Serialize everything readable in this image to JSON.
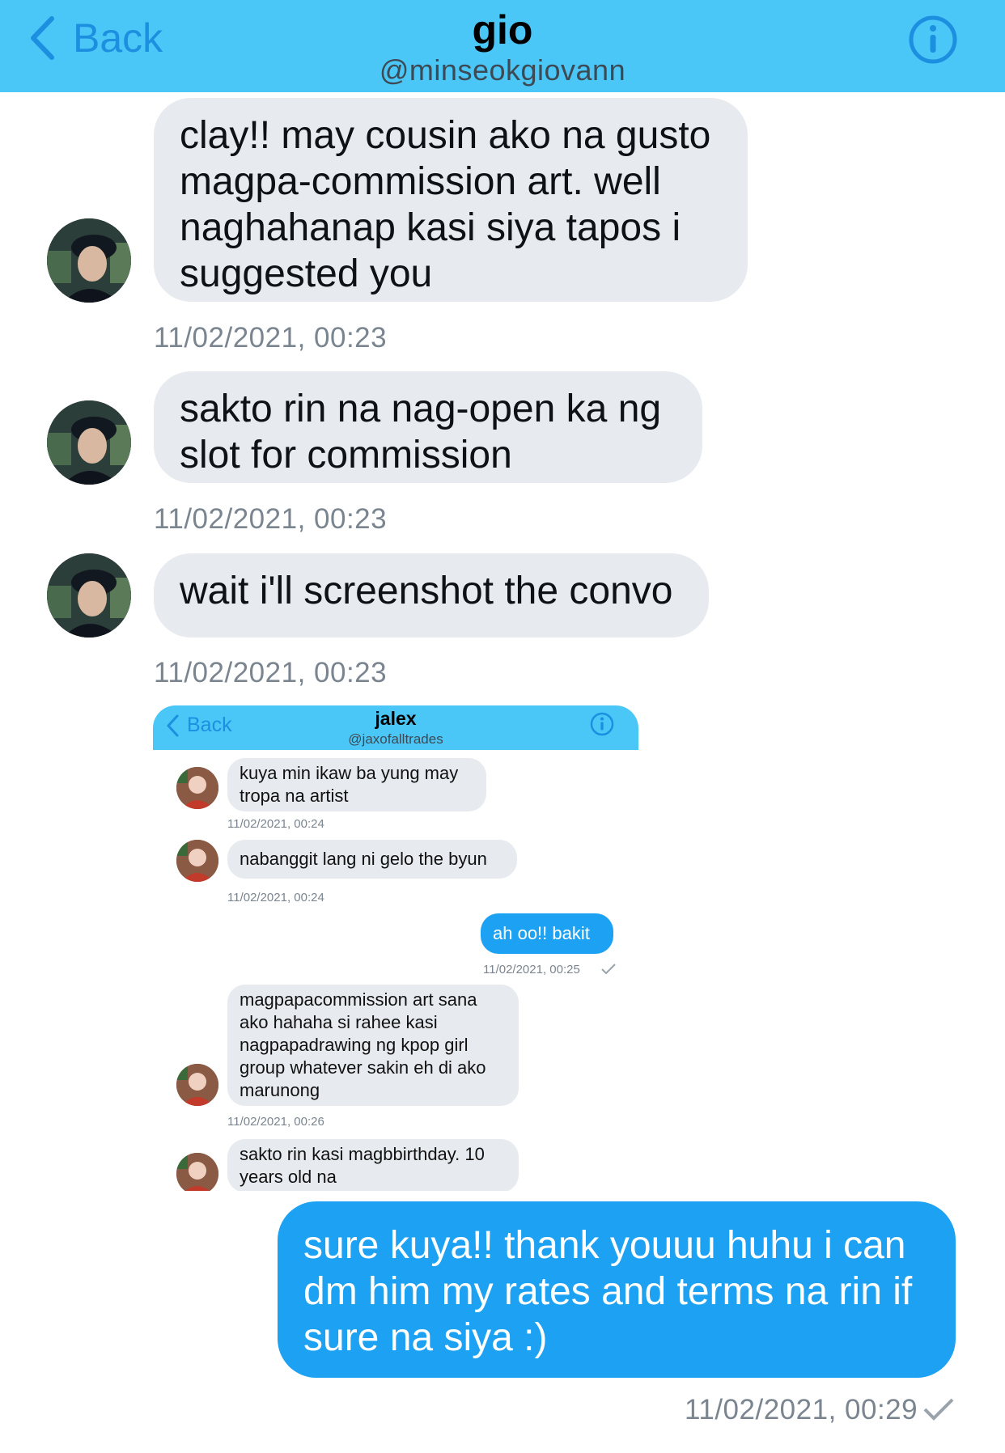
{
  "header": {
    "back_label": "Back",
    "title": "gio",
    "handle": "@minseokgiovann"
  },
  "messages": [
    {
      "text": "clay!! may cousin ako na gusto magpa-commission art. well naghahanap kasi siya tapos i suggested you",
      "timestamp": "11/02/2021, 00:23"
    },
    {
      "text": "sakto rin na nag-open ka ng slot for commission",
      "timestamp": "11/02/2021, 00:23"
    },
    {
      "text": "wait i'll screenshot the convo",
      "timestamp": "11/02/2021, 00:23"
    }
  ],
  "embedded_screenshot": {
    "header": {
      "back_label": "Back",
      "title": "jalex",
      "handle": "@jaxofalltrades"
    },
    "messages": [
      {
        "text": "kuya min ikaw ba yung may tropa na artist",
        "timestamp": "11/02/2021, 00:24"
      },
      {
        "text": "nabanggit lang ni gelo the byun",
        "timestamp": "11/02/2021, 00:24"
      },
      {
        "text": "ah oo!! bakit",
        "timestamp": "11/02/2021, 00:25"
      },
      {
        "text": "magpapacommission art sana ako hahaha si rahee kasi nagpapadrawing ng kpop girl group whatever sakin eh di ako marunong",
        "timestamp": "11/02/2021, 00:26"
      },
      {
        "text": "sakto rin kasi magbbirthday. 10 years old na"
      }
    ]
  },
  "reply": {
    "text": "sure kuya!! thank youuu huhu i can dm him my rates and terms na rin if sure na siya :)",
    "timestamp": "11/02/2021, 00:29"
  },
  "colors": {
    "header_bg": "#4ac7f6",
    "accent": "#1d8fe0",
    "outgoing_bubble": "#1da1f2",
    "incoming_bubble": "#e7ebef"
  }
}
